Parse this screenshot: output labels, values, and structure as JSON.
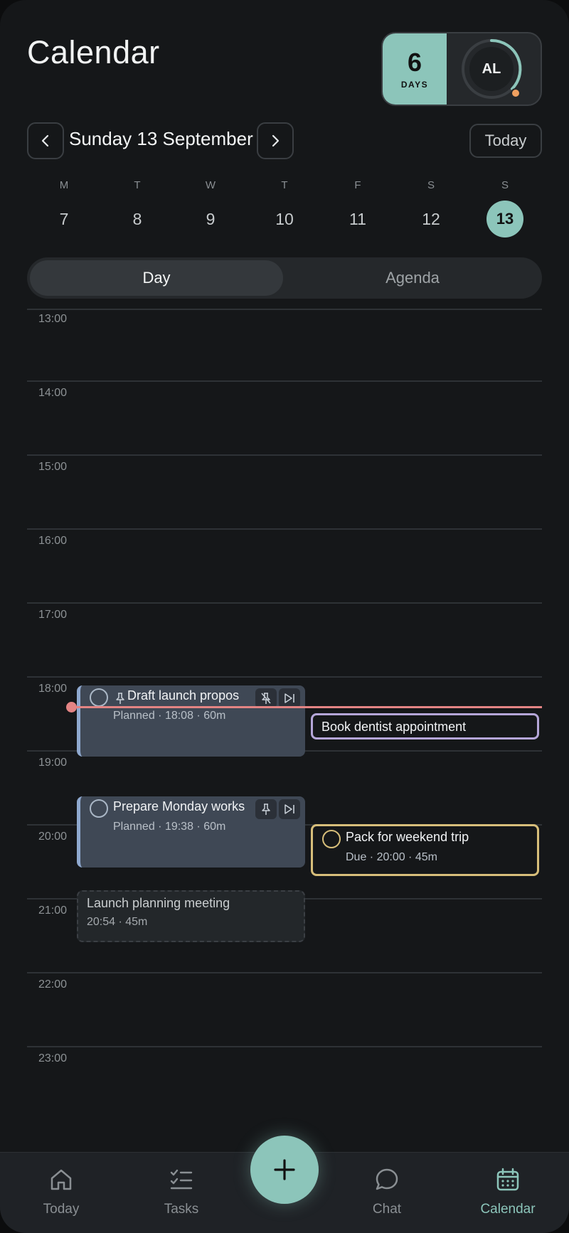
{
  "header": {
    "title": "Calendar"
  },
  "streak": {
    "count": "6",
    "label": "DAYS",
    "avatar_initials": "AL"
  },
  "date_nav": {
    "label": "Sunday 13 September",
    "today_label": "Today"
  },
  "week": [
    {
      "letter": "M",
      "num": "7"
    },
    {
      "letter": "T",
      "num": "8"
    },
    {
      "letter": "W",
      "num": "9"
    },
    {
      "letter": "T",
      "num": "10"
    },
    {
      "letter": "F",
      "num": "11"
    },
    {
      "letter": "S",
      "num": "12"
    },
    {
      "letter": "S",
      "num": "13",
      "selected": true
    }
  ],
  "view_toggle": {
    "day": "Day",
    "agenda": "Agenda",
    "active": "Day"
  },
  "hours": [
    "13:00",
    "14:00",
    "15:00",
    "16:00",
    "17:00",
    "18:00",
    "19:00",
    "20:00",
    "21:00",
    "22:00",
    "23:00"
  ],
  "events": [
    {
      "title": "Draft launch propos",
      "sub": "Planned · 18:08 · 60m"
    },
    {
      "title": "Book dentist appointment"
    },
    {
      "title": "Prepare Monday works",
      "sub": "Planned · 19:38 · 60m"
    },
    {
      "title": "Pack for weekend trip",
      "sub": "Due · 20:00 · 45m"
    },
    {
      "title": "Launch planning meeting",
      "sub": "20:54 · 45m"
    }
  ],
  "tabs": [
    {
      "label": "Today",
      "icon": "home-icon"
    },
    {
      "label": "Tasks",
      "icon": "tasks-icon"
    },
    {
      "label": "Chat",
      "icon": "chat-icon"
    },
    {
      "label": "Calendar",
      "icon": "calendar-icon",
      "active": true
    }
  ],
  "colors": {
    "accent": "#8cc5ba",
    "now_line": "#e38484",
    "planned": "#8fa9cf",
    "purple": "#b5a6d8",
    "gold": "#d7be7a"
  }
}
